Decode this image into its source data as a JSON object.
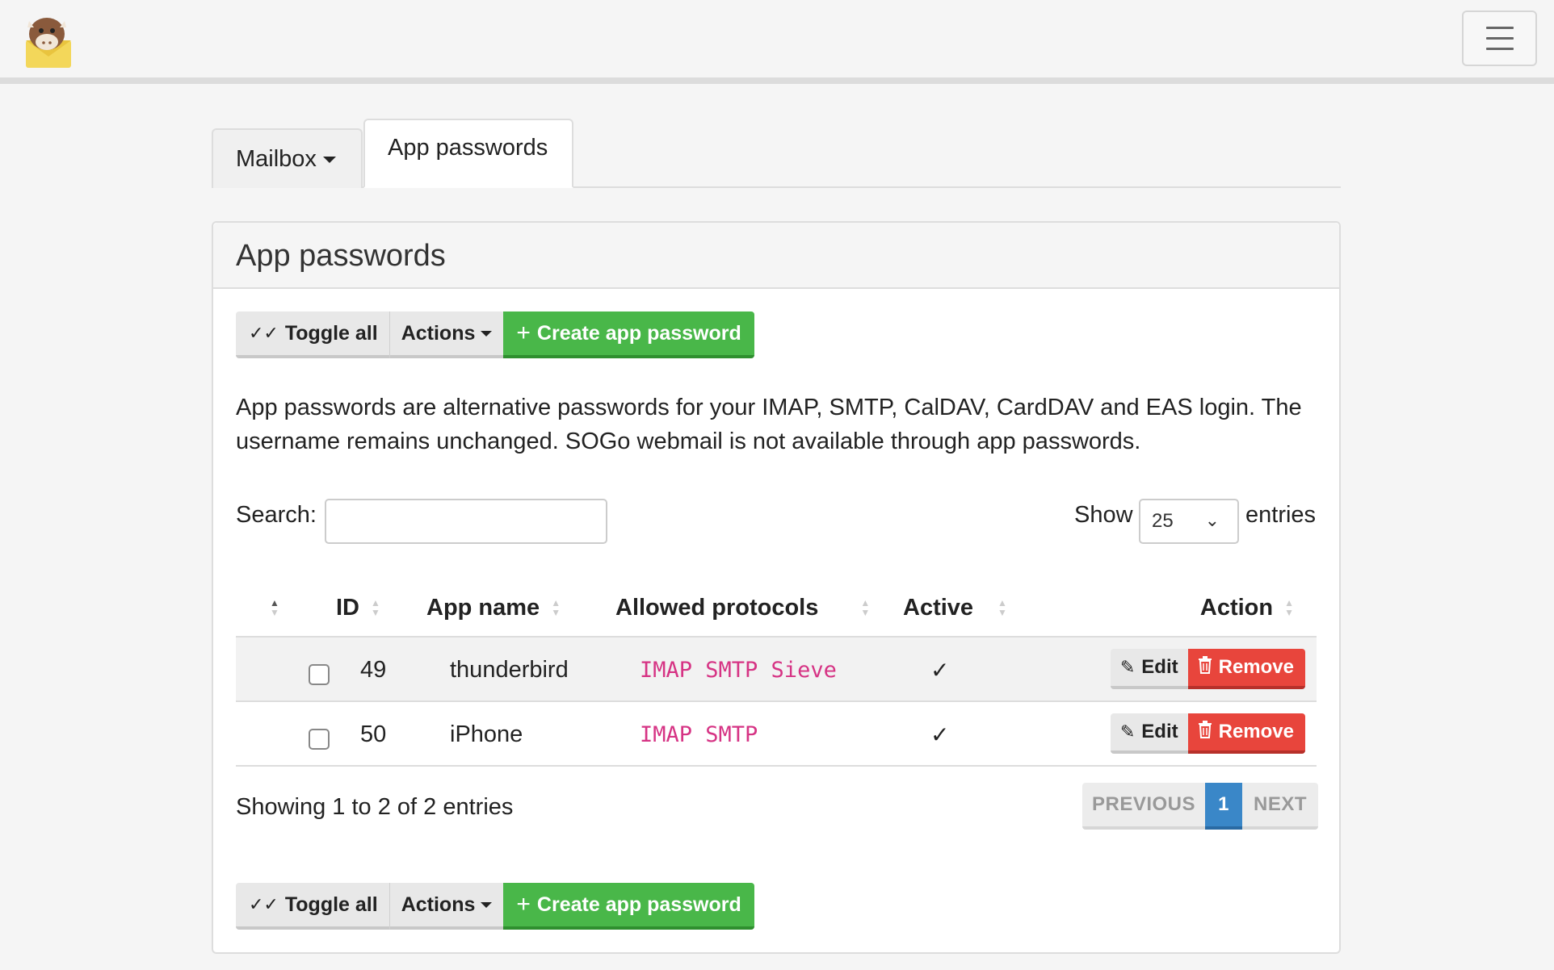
{
  "navbar": {
    "logo_alt": "mailcow logo",
    "menu_icon": "hamburger-menu-icon"
  },
  "tabs": [
    {
      "label": "Mailbox"
    },
    {
      "label": "App passwords"
    }
  ],
  "panel": {
    "title": "App passwords",
    "toolbar": {
      "toggle_all": "Toggle all",
      "actions": "Actions",
      "create": "Create app password"
    },
    "description": "App passwords are alternative passwords for your IMAP, SMTP, CalDAV, CardDAV and EAS login. The username remains unchanged. SOGo webmail is not available through app passwords.",
    "search": {
      "label": "Search:",
      "value": ""
    },
    "length": {
      "show": "Show",
      "value": "25",
      "entries": "entries"
    },
    "table": {
      "headers": {
        "id": "ID",
        "app_name": "App name",
        "protocols": "Allowed protocols",
        "active": "Active",
        "action": "Action"
      },
      "rows": [
        {
          "id": "49",
          "app_name": "thunderbird",
          "protocols": "IMAP SMTP Sieve",
          "active": "✓",
          "edit": "Edit",
          "remove": "Remove"
        },
        {
          "id": "50",
          "app_name": "iPhone",
          "protocols": "IMAP SMTP",
          "active": "✓",
          "edit": "Edit",
          "remove": "Remove"
        }
      ]
    },
    "info": "Showing 1 to 2 of 2 entries",
    "pagination": {
      "previous": "PREVIOUS",
      "current": "1",
      "next": "NEXT"
    }
  },
  "colors": {
    "success": "#49b749",
    "danger": "#e8453c",
    "primary": "#3a87c8",
    "code": "#d63384"
  }
}
